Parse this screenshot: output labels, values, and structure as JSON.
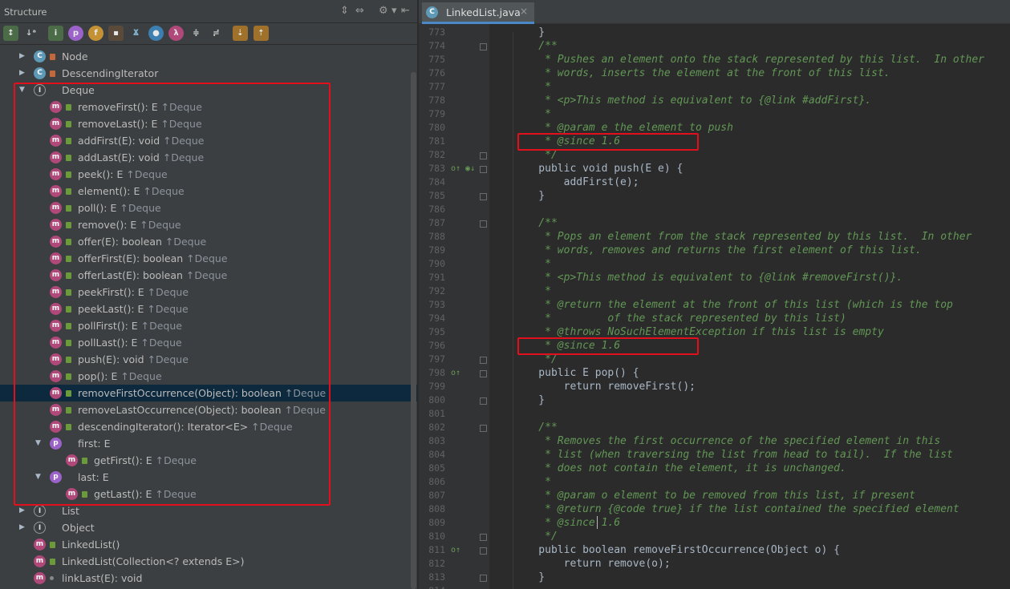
{
  "structure_panel": {
    "title": "Structure",
    "toolbar_icons": [
      "sort-by-visibility-icon",
      "sort-alphabetically-icon",
      "show-inherited-icon",
      "show-properties-icon",
      "show-fields-icon",
      "show-non-public-icon",
      "show-anonymous-icon",
      "show-lambdas-icon",
      "expand-all-icon",
      "collapse-all-icon",
      "autoscroll-to-source-icon",
      "autoscroll-from-source-icon"
    ],
    "tree": [
      {
        "text": "Node",
        "origin": "",
        "kind": "class",
        "vis": "private",
        "depth": 1,
        "arrow": "right"
      },
      {
        "text": "DescendingIterator",
        "origin": "",
        "kind": "class",
        "vis": "private",
        "depth": 1,
        "arrow": "right"
      },
      {
        "text": "Deque",
        "origin": "",
        "kind": "interface",
        "vis": "",
        "depth": 1,
        "arrow": "down"
      },
      {
        "text": "removeFirst(): E",
        "origin": "↑Deque",
        "kind": "method",
        "vis": "public",
        "depth": 3,
        "arrow": ""
      },
      {
        "text": "removeLast(): E",
        "origin": "↑Deque",
        "kind": "method",
        "vis": "public",
        "depth": 3,
        "arrow": ""
      },
      {
        "text": "addFirst(E): void",
        "origin": "↑Deque",
        "kind": "method",
        "vis": "public",
        "depth": 3,
        "arrow": ""
      },
      {
        "text": "addLast(E): void",
        "origin": "↑Deque",
        "kind": "method",
        "vis": "public",
        "depth": 3,
        "arrow": ""
      },
      {
        "text": "peek(): E",
        "origin": "↑Deque",
        "kind": "method",
        "vis": "public",
        "depth": 3,
        "arrow": ""
      },
      {
        "text": "element(): E",
        "origin": "↑Deque",
        "kind": "method",
        "vis": "public",
        "depth": 3,
        "arrow": ""
      },
      {
        "text": "poll(): E",
        "origin": "↑Deque",
        "kind": "method",
        "vis": "public",
        "depth": 3,
        "arrow": ""
      },
      {
        "text": "remove(): E",
        "origin": "↑Deque",
        "kind": "method",
        "vis": "public",
        "depth": 3,
        "arrow": ""
      },
      {
        "text": "offer(E): boolean",
        "origin": "↑Deque",
        "kind": "method",
        "vis": "public",
        "depth": 3,
        "arrow": ""
      },
      {
        "text": "offerFirst(E): boolean",
        "origin": "↑Deque",
        "kind": "method",
        "vis": "public",
        "depth": 3,
        "arrow": ""
      },
      {
        "text": "offerLast(E): boolean",
        "origin": "↑Deque",
        "kind": "method",
        "vis": "public",
        "depth": 3,
        "arrow": ""
      },
      {
        "text": "peekFirst(): E",
        "origin": "↑Deque",
        "kind": "method",
        "vis": "public",
        "depth": 3,
        "arrow": ""
      },
      {
        "text": "peekLast(): E",
        "origin": "↑Deque",
        "kind": "method",
        "vis": "public",
        "depth": 3,
        "arrow": ""
      },
      {
        "text": "pollFirst(): E",
        "origin": "↑Deque",
        "kind": "method",
        "vis": "public",
        "depth": 3,
        "arrow": ""
      },
      {
        "text": "pollLast(): E",
        "origin": "↑Deque",
        "kind": "method",
        "vis": "public",
        "depth": 3,
        "arrow": ""
      },
      {
        "text": "push(E): void",
        "origin": "↑Deque",
        "kind": "method",
        "vis": "public",
        "depth": 3,
        "arrow": ""
      },
      {
        "text": "pop(): E",
        "origin": "↑Deque",
        "kind": "method",
        "vis": "public",
        "depth": 3,
        "arrow": ""
      },
      {
        "text": "removeFirstOccurrence(Object): boolean",
        "origin": "↑Deque",
        "kind": "method",
        "vis": "public",
        "depth": 3,
        "arrow": "",
        "selected": true
      },
      {
        "text": "removeLastOccurrence(Object): boolean",
        "origin": "↑Deque",
        "kind": "method",
        "vis": "public",
        "depth": 3,
        "arrow": ""
      },
      {
        "text": "descendingIterator(): Iterator<E>",
        "origin": "↑Deque",
        "kind": "method",
        "vis": "public",
        "depth": 3,
        "arrow": ""
      },
      {
        "text": "first: E",
        "origin": "",
        "kind": "property",
        "vis": "",
        "depth": 2,
        "arrow": "down"
      },
      {
        "text": "getFirst(): E",
        "origin": "↑Deque",
        "kind": "method",
        "vis": "public",
        "depth": 4,
        "arrow": ""
      },
      {
        "text": "last: E",
        "origin": "",
        "kind": "property",
        "vis": "",
        "depth": 2,
        "arrow": "down"
      },
      {
        "text": "getLast(): E",
        "origin": "↑Deque",
        "kind": "method",
        "vis": "public",
        "depth": 4,
        "arrow": ""
      },
      {
        "text": "List",
        "origin": "",
        "kind": "interface",
        "vis": "",
        "depth": 1,
        "arrow": "right"
      },
      {
        "text": "Object",
        "origin": "",
        "kind": "interface",
        "vis": "",
        "depth": 1,
        "arrow": "right"
      },
      {
        "text": "LinkedList()",
        "origin": "",
        "kind": "method",
        "vis": "public",
        "depth": 0,
        "arrow": ""
      },
      {
        "text": "LinkedList(Collection<? extends E>)",
        "origin": "",
        "kind": "method",
        "vis": "public",
        "depth": 0,
        "arrow": ""
      },
      {
        "text": "linkLast(E): void",
        "origin": "",
        "kind": "method",
        "vis": "package",
        "depth": 0,
        "arrow": ""
      }
    ]
  },
  "editor": {
    "tab": {
      "label": "LinkedList.java",
      "icon": "class-icon",
      "close": "×"
    },
    "lines": [
      {
        "n": "773",
        "t": "    }",
        "c": false
      },
      {
        "n": "774",
        "t": "    /**",
        "c": true
      },
      {
        "n": "775",
        "t": "     * Pushes an element onto the stack represented by this list.  In other",
        "c": true
      },
      {
        "n": "776",
        "t": "     * words, inserts the element at the front of this list.",
        "c": true
      },
      {
        "n": "777",
        "t": "     *",
        "c": true
      },
      {
        "n": "778",
        "t": "     * <p>This method is equivalent to {@link #addFirst}.",
        "c": true
      },
      {
        "n": "779",
        "t": "     *",
        "c": true
      },
      {
        "n": "780",
        "t": "     * @param e the element to push",
        "c": true
      },
      {
        "n": "781",
        "t": "     * @since 1.6",
        "c": true
      },
      {
        "n": "782",
        "t": "     */",
        "c": true
      },
      {
        "n": "783",
        "t": "    public void push(E e) {",
        "c": false
      },
      {
        "n": "784",
        "t": "        addFirst(e);",
        "c": false
      },
      {
        "n": "785",
        "t": "    }",
        "c": false
      },
      {
        "n": "786",
        "t": "",
        "c": false
      },
      {
        "n": "787",
        "t": "    /**",
        "c": true
      },
      {
        "n": "788",
        "t": "     * Pops an element from the stack represented by this list.  In other",
        "c": true
      },
      {
        "n": "789",
        "t": "     * words, removes and returns the first element of this list.",
        "c": true
      },
      {
        "n": "790",
        "t": "     *",
        "c": true
      },
      {
        "n": "791",
        "t": "     * <p>This method is equivalent to {@link #removeFirst()}.",
        "c": true
      },
      {
        "n": "792",
        "t": "     *",
        "c": true
      },
      {
        "n": "793",
        "t": "     * @return the element at the front of this list (which is the top",
        "c": true
      },
      {
        "n": "794",
        "t": "     *         of the stack represented by this list)",
        "c": true
      },
      {
        "n": "795",
        "t": "     * @throws NoSuchElementException if this list is empty",
        "c": true
      },
      {
        "n": "796",
        "t": "     * @since 1.6",
        "c": true
      },
      {
        "n": "797",
        "t": "     */",
        "c": true
      },
      {
        "n": "798",
        "t": "    public E pop() {",
        "c": false
      },
      {
        "n": "799",
        "t": "        return removeFirst();",
        "c": false
      },
      {
        "n": "800",
        "t": "    }",
        "c": false
      },
      {
        "n": "801",
        "t": "",
        "c": false
      },
      {
        "n": "802",
        "t": "    /**",
        "c": true
      },
      {
        "n": "803",
        "t": "     * Removes the first occurrence of the specified element in this",
        "c": true
      },
      {
        "n": "804",
        "t": "     * list (when traversing the list from head to tail).  If the list",
        "c": true
      },
      {
        "n": "805",
        "t": "     * does not contain the element, it is unchanged.",
        "c": true
      },
      {
        "n": "806",
        "t": "     *",
        "c": true
      },
      {
        "n": "807",
        "t": "     * @param o element to be removed from this list, if present",
        "c": true
      },
      {
        "n": "808",
        "t": "     * @return {@code true} if the list contained the specified element",
        "c": true
      },
      {
        "n": "809",
        "t": "     * @since 1.6",
        "c": true
      },
      {
        "n": "810",
        "t": "     */",
        "c": true
      },
      {
        "n": "811",
        "t": "    public boolean removeFirstOccurrence(Object o) {",
        "c": false
      },
      {
        "n": "812",
        "t": "        return remove(o);",
        "c": false
      },
      {
        "n": "813",
        "t": "    }",
        "c": false
      },
      {
        "n": "814",
        "t": "",
        "c": false
      }
    ],
    "gutter_marks": {
      "783": "o↑ ◉↓",
      "798": "o↑",
      "811": "o↑"
    }
  },
  "colors": {
    "comment": "#629755",
    "code": "#a9b7c6",
    "selection": "#0d293e",
    "highlight_box": "#e2101d",
    "tab_underline": "#4a88c7"
  }
}
